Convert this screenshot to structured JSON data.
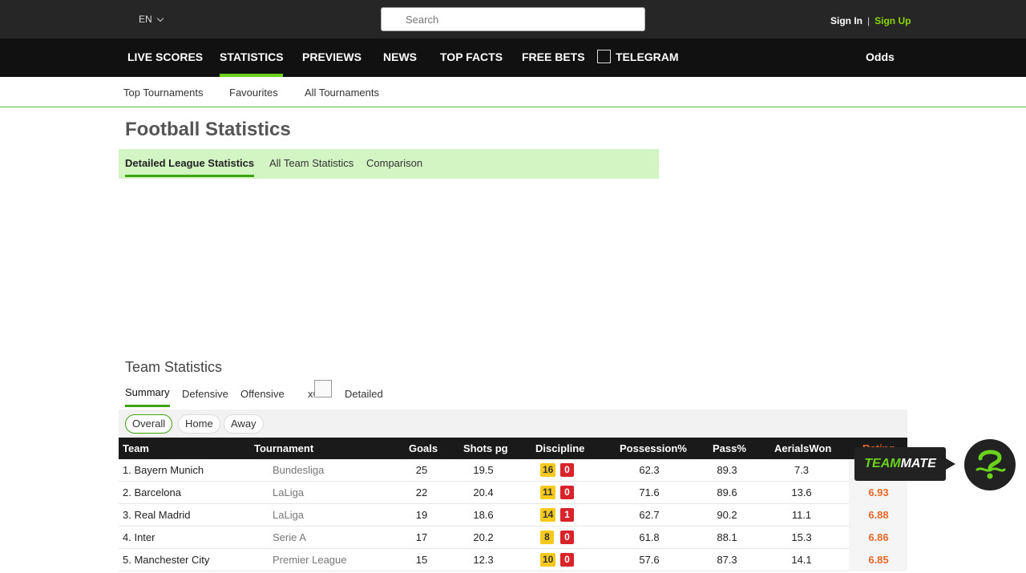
{
  "topbar": {
    "language": "EN",
    "search_placeholder": "Search",
    "sign_in": "Sign In",
    "separator": "|",
    "sign_up": "Sign Up"
  },
  "main_nav": {
    "items": [
      "LIVE SCORES",
      "STATISTICS",
      "PREVIEWS",
      "NEWS",
      "TOP FACTS",
      "FREE BETS",
      "TELEGRAM"
    ],
    "active": "STATISTICS",
    "odds": "Odds"
  },
  "sub_nav": [
    "Top Tournaments",
    "Favourites",
    "All Tournaments"
  ],
  "page_title": "Football Statistics",
  "tabs": {
    "items": [
      "Detailed League Statistics",
      "All Team Statistics",
      "Comparison"
    ],
    "active": "Detailed League Statistics"
  },
  "section_title": "Team Statistics",
  "sub_tabs": {
    "items": [
      "Summary",
      "Defensive",
      "Offensive",
      "xG",
      "Detailed"
    ],
    "active": "Summary"
  },
  "filters": {
    "items": [
      "Overall",
      "Home",
      "Away"
    ],
    "active": "Overall"
  },
  "table": {
    "headers": [
      "Team",
      "Tournament",
      "Goals",
      "Shots pg",
      "Discipline",
      "Possession%",
      "Pass%",
      "AerialsWon",
      "Rating"
    ],
    "rows": [
      {
        "team": "1. Bayern Munich",
        "tournament": "Bundesliga",
        "goals": "25",
        "shots": "19.5",
        "yellow": "16",
        "red": "0",
        "possession": "62.3",
        "pass": "89.3",
        "aerials": "7.3",
        "rating": ""
      },
      {
        "team": "2. Barcelona",
        "tournament": "LaLiga",
        "goals": "22",
        "shots": "20.4",
        "yellow": "11",
        "red": "0",
        "possession": "71.6",
        "pass": "89.6",
        "aerials": "13.6",
        "rating": "6.93"
      },
      {
        "team": "3. Real Madrid",
        "tournament": "LaLiga",
        "goals": "19",
        "shots": "18.6",
        "yellow": "14",
        "red": "1",
        "possession": "62.7",
        "pass": "90.2",
        "aerials": "11.1",
        "rating": "6.88"
      },
      {
        "team": "4. Inter",
        "tournament": "Serie A",
        "goals": "17",
        "shots": "20.2",
        "yellow": "8",
        "red": "0",
        "possession": "61.8",
        "pass": "88.1",
        "aerials": "15.3",
        "rating": "6.86"
      },
      {
        "team": "5. Manchester City",
        "tournament": "Premier League",
        "goals": "15",
        "shots": "12.3",
        "yellow": "10",
        "red": "0",
        "possession": "57.6",
        "pass": "87.3",
        "aerials": "14.1",
        "rating": "6.85"
      }
    ]
  },
  "teammate": {
    "part1": "TEAM",
    "part2": "MATE"
  },
  "colors": {
    "accent_green": "#6ad21c",
    "rating_orange": "#e8682a",
    "yellow_card": "#f7c91c",
    "red_card": "#d8232a"
  }
}
